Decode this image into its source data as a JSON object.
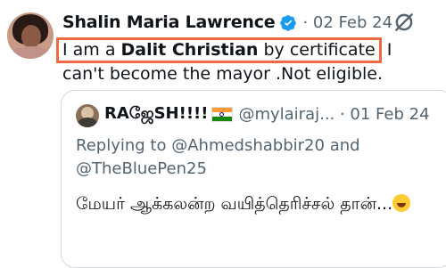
{
  "tweet": {
    "author_name": "Shalin Maria Lawrence",
    "meta": "· 02 Feb 24",
    "text_pre": "I am a ",
    "text_bold": "Dalit Christian",
    "text_post": " by certificate",
    "text_rest": " I can't become the mayor .Not eligible.",
    "highlight_color": "#f06a41",
    "verified_color": "#1d9bf0"
  },
  "quote": {
    "author_name": "RAஜேSH!!!!",
    "meta": "@mylairaj... · 01 Feb 24",
    "replying_prefix": "Replying to",
    "mention1": "@Ahmedshabbir20",
    "and": "and",
    "mention2": "@TheBluePen25",
    "text": "மேயர் ஆக்கலன்ற வயித்தெரிச்சல் தான்...",
    "flag_icon": "india-flag-icon",
    "emoji_icon": "laughing-emoji-icon"
  }
}
